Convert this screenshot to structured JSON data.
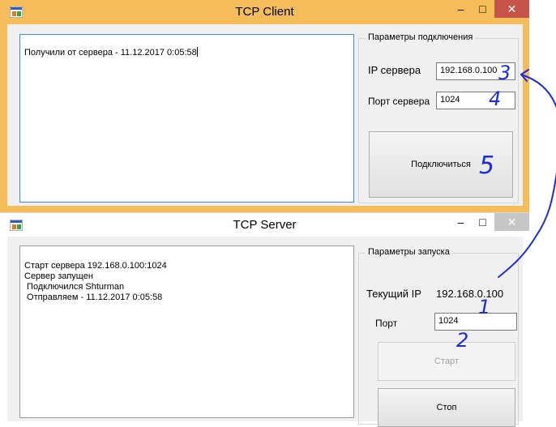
{
  "client": {
    "title": "TCP Client",
    "log": [
      "Получили от сервера - 11.12.2017 0:05:58"
    ],
    "group_title": "Параметры подключения",
    "ip_label": "IP сервера",
    "ip_value": "192.168.0.100",
    "port_label": "Порт сервера",
    "port_value": "1024",
    "connect_button": "Подключиться",
    "controls": {
      "minimize": "–",
      "maximize": "□",
      "close": "✕"
    }
  },
  "server": {
    "title": "TCP Server",
    "log": [
      "Старт сервера 192.168.0.100:1024",
      "Сервер запущен",
      " Подключился Shturman",
      " Отправляем - 11.12.2017 0:05:58"
    ],
    "group_title": "Параметры запуска",
    "current_ip_label": "Текущий IP",
    "current_ip_value": "192.168.0.100",
    "port_label": "Порт",
    "port_value": "1024",
    "start_button": "Старт",
    "stop_button": "Стоп",
    "controls": {
      "minimize": "–",
      "maximize": "□",
      "close": "✕"
    }
  },
  "annotations": [
    "1",
    "2",
    "3",
    "4",
    "5"
  ],
  "colors": {
    "client_frame": "#f5bd59",
    "close_active": "#c7544a",
    "ink": "#1b2be0"
  }
}
